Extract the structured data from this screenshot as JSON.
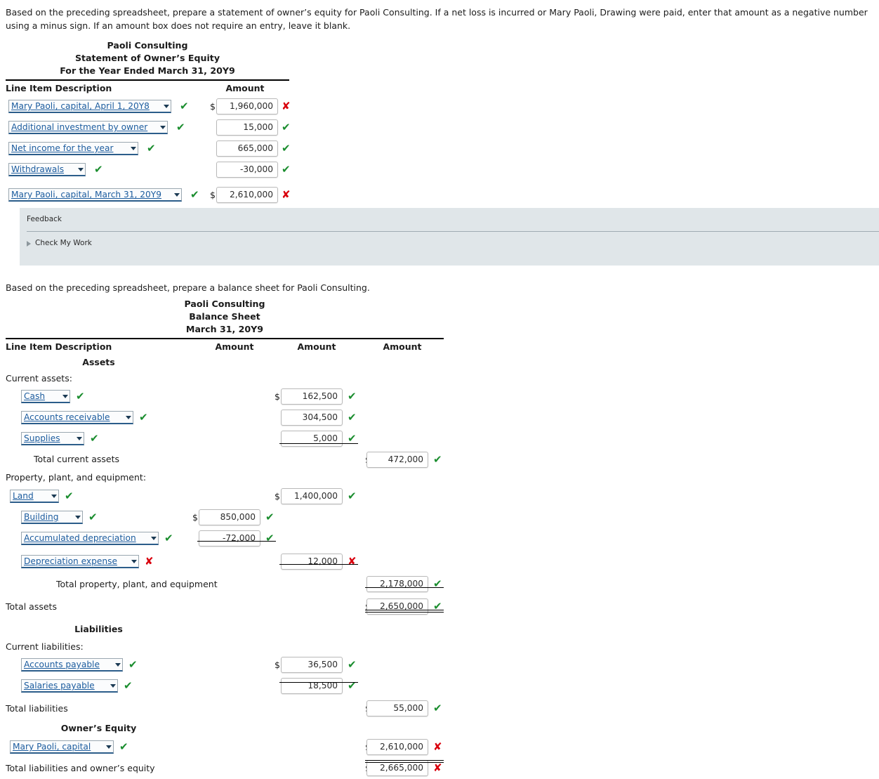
{
  "prompts": {
    "equity": "Based on the preceding spreadsheet, prepare a statement of owner’s equity for Paoli Consulting. If a net loss is incurred or Mary Paoli, Drawing were paid, enter that amount as a negative number using a minus sign. If an amount box does not require an entry, leave it blank.",
    "balance": "Based on the preceding spreadsheet, prepare a balance sheet for Paoli Consulting."
  },
  "colors": {
    "correct": "#1a8d2e",
    "incorrect": "#d9000d",
    "select_text": "#1c5c9e",
    "feedback_bg": "#e0e6e9"
  },
  "marks": {
    "correct": "✔",
    "incorrect": "✘"
  },
  "equity_statement": {
    "company": "Paoli Consulting",
    "title": "Statement of Owner’s Equity",
    "period": "For the Year Ended March 31, 20Y9",
    "headers": {
      "description": "Line Item Description",
      "amount": "Amount"
    },
    "rows": [
      {
        "label": "Mary Paoli, capital, April 1, 20Y8",
        "label_mark": "correct",
        "dollar": "$",
        "amount": "1,960,000",
        "amount_mark": "incorrect"
      },
      {
        "label": "Additional investment by owner",
        "label_mark": "correct",
        "dollar": "",
        "amount": "15,000",
        "amount_mark": "correct"
      },
      {
        "label": "Net income for the year",
        "label_mark": "correct",
        "dollar": "",
        "amount": "665,000",
        "amount_mark": "correct"
      },
      {
        "label": "Withdrawals",
        "label_mark": "correct",
        "dollar": "",
        "amount": "-30,000",
        "amount_mark": "correct"
      },
      {
        "label": "Mary Paoli, capital, March 31, 20Y9",
        "label_mark": "correct",
        "dollar": "$",
        "amount": "2,610,000",
        "amount_mark": "incorrect"
      }
    ]
  },
  "feedback": {
    "title": "Feedback",
    "check_my_work": "Check My Work"
  },
  "balance_sheet": {
    "company": "Paoli Consulting",
    "title": "Balance Sheet",
    "period": "March 31, 20Y9",
    "headers": {
      "description": "Line Item Description",
      "amount1": "Amount",
      "amount2": "Amount",
      "amount3": "Amount"
    },
    "sections": {
      "assets": "Assets",
      "liabilities": "Liabilities",
      "owners_equity": "Owner’s Equity"
    },
    "subheads": {
      "current_assets": "Current assets:",
      "ppe": "Property, plant, and equipment:",
      "current_liabilities": "Current liabilities:"
    },
    "totals": {
      "total_current_assets": "Total current assets",
      "total_ppe": "Total property, plant, and equipment",
      "total_assets": "Total assets",
      "total_liabilities": "Total liabilities",
      "total_liab_equity": "Total liabilities and owner’s equity"
    },
    "rows": [
      {
        "label": "Cash",
        "label_mark": "correct",
        "col": 2,
        "dollar": "$",
        "amount": "162,500",
        "amount_mark": "correct"
      },
      {
        "label": "Accounts receivable",
        "label_mark": "correct",
        "col": 2,
        "dollar": "",
        "amount": "304,500",
        "amount_mark": "correct"
      },
      {
        "label": "Supplies",
        "label_mark": "correct",
        "col": 2,
        "dollar": "",
        "amount": "5,000",
        "amount_mark": "correct"
      },
      {
        "label": "Land",
        "label_mark": "correct",
        "col": 2,
        "dollar": "$",
        "amount": "1,400,000",
        "amount_mark": "correct"
      },
      {
        "label": "Building",
        "label_mark": "correct",
        "col": 1,
        "dollar": "$",
        "amount": "850,000",
        "amount_mark": "correct"
      },
      {
        "label": "Accumulated depreciation",
        "label_mark": "correct",
        "col": 1,
        "dollar": "",
        "amount": "-72,000",
        "amount_mark": "correct"
      },
      {
        "label": "Depreciation expense",
        "label_mark": "incorrect",
        "col": 2,
        "dollar": "",
        "amount": "12,000",
        "amount_mark": "incorrect"
      },
      {
        "label": "Accounts payable",
        "label_mark": "correct",
        "col": 2,
        "dollar": "$",
        "amount": "36,500",
        "amount_mark": "correct"
      },
      {
        "label": "Salaries payable",
        "label_mark": "correct",
        "col": 2,
        "dollar": "",
        "amount": "18,500",
        "amount_mark": "correct"
      },
      {
        "label": "Mary Paoli, capital",
        "label_mark": "correct",
        "col": 3,
        "dollar": "$",
        "amount": "2,610,000",
        "amount_mark": "incorrect"
      }
    ],
    "total_values": {
      "total_current_assets": {
        "dollar": "$",
        "amount": "472,000",
        "amount_mark": "correct"
      },
      "total_ppe": {
        "dollar": "",
        "amount": "2,178,000",
        "amount_mark": "correct"
      },
      "total_assets": {
        "dollar": "$",
        "amount": "2,650,000",
        "amount_mark": "correct"
      },
      "total_liabilities": {
        "dollar": "$",
        "amount": "55,000",
        "amount_mark": "correct"
      },
      "total_liab_equity": {
        "dollar": "$",
        "amount": "2,665,000",
        "amount_mark": "incorrect"
      }
    }
  }
}
